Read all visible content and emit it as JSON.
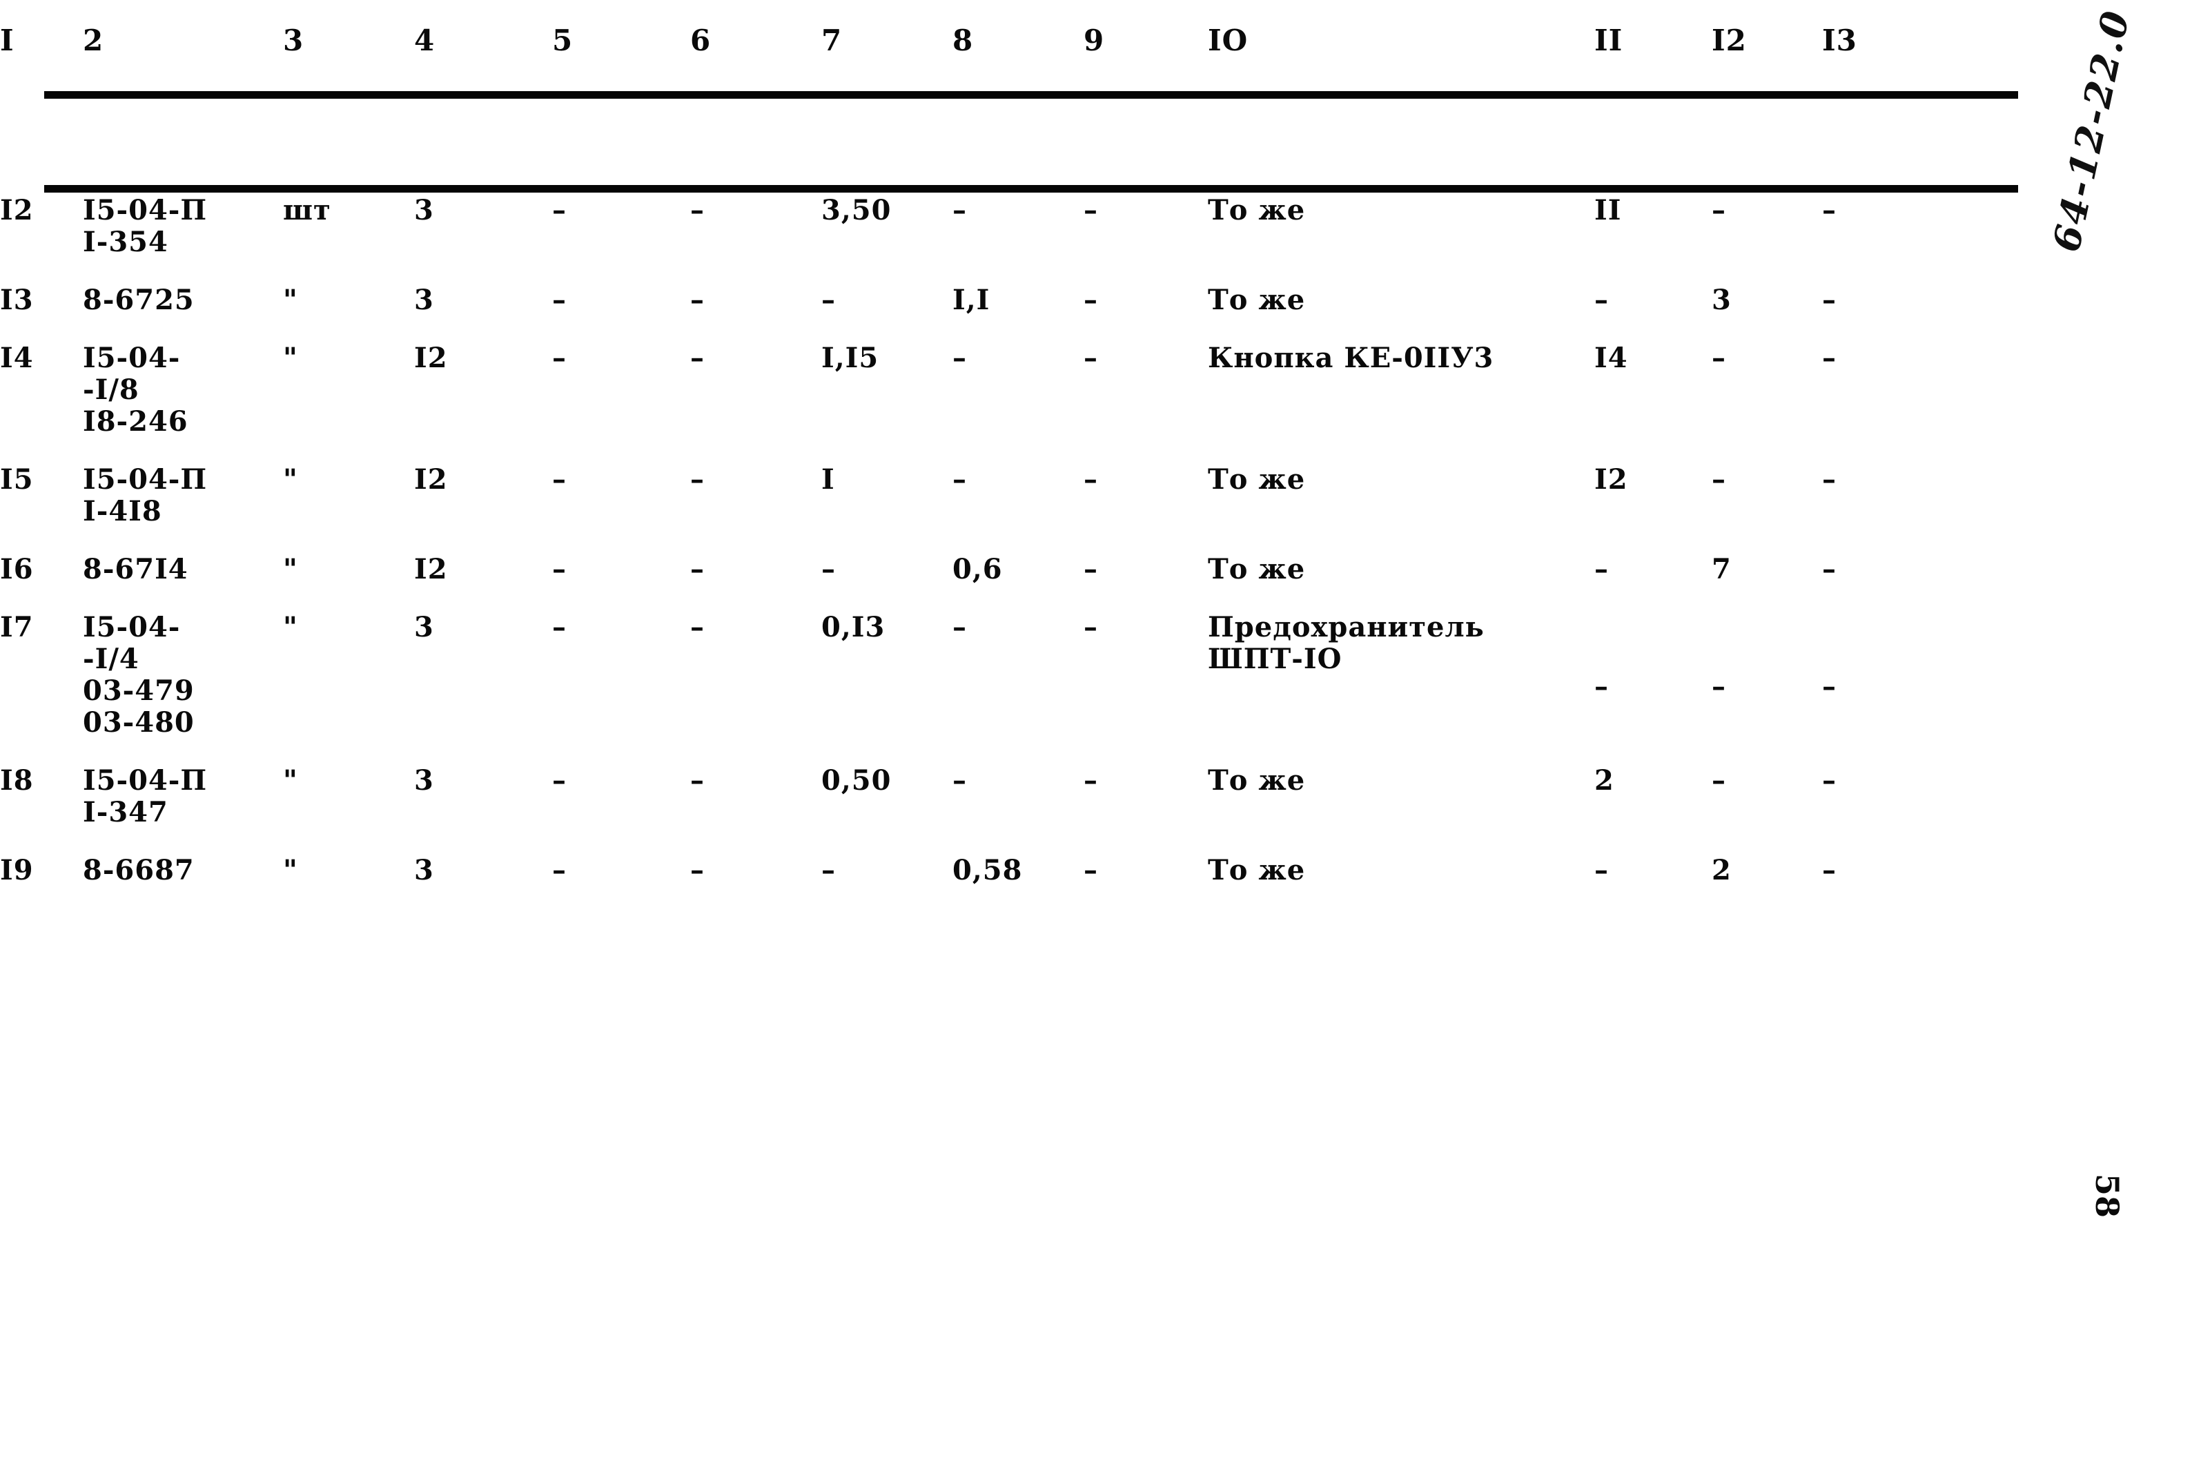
{
  "document": {
    "page_number": "58",
    "margin_note": "64-12-22.0"
  },
  "table": {
    "column_headers": [
      "I",
      "2",
      "3",
      "4",
      "5",
      "6",
      "7",
      "8",
      "9",
      "IO",
      "II",
      "I2",
      "I3"
    ],
    "rows": [
      {
        "c1": "I2",
        "c2_lines": [
          "I5-04-П",
          "I-354"
        ],
        "c3": "шт",
        "c4": "3",
        "c5": "–",
        "c6": "–",
        "c7": "3,50",
        "c8": "–",
        "c9": "–",
        "c10_lines": [
          "То же"
        ],
        "c11": "II",
        "c12": "–",
        "c13": "–"
      },
      {
        "c1": "I3",
        "c2_lines": [
          "8-6725"
        ],
        "c3": "\"",
        "c4": "3",
        "c5": "–",
        "c6": "–",
        "c7": "–",
        "c8": "I,I",
        "c9": "–",
        "c10_lines": [
          "То же"
        ],
        "c11": "–",
        "c12": "3",
        "c13": "–"
      },
      {
        "c1": "I4",
        "c2_lines": [
          "I5-04-",
          "-I/8",
          "I8-246"
        ],
        "c3": "\"",
        "c4": "I2",
        "c5": "–",
        "c6": "–",
        "c7": "I,I5",
        "c8": "–",
        "c9": "–",
        "c10_lines": [
          "Кнопка КЕ-0IIУ3"
        ],
        "c11": "I4",
        "c12": "–",
        "c13": "–"
      },
      {
        "c1": "I5",
        "c2_lines": [
          "I5-04-П",
          "I-4I8"
        ],
        "c3": "\"",
        "c4": "I2",
        "c5": "–",
        "c6": "–",
        "c7": "I",
        "c8": "–",
        "c9": "–",
        "c10_lines": [
          "То же"
        ],
        "c11": "I2",
        "c12": "–",
        "c13": "–"
      },
      {
        "c1": "I6",
        "c2_lines": [
          "8-67I4"
        ],
        "c3": "\"",
        "c4": "I2",
        "c5": "–",
        "c6": "–",
        "c7": "–",
        "c8": "0,6",
        "c9": "–",
        "c10_lines": [
          "То же"
        ],
        "c11": "–",
        "c12": "7",
        "c13": "–"
      },
      {
        "c1": "I7",
        "c2_lines": [
          "I5-04-",
          "-I/4",
          "03-479",
          "03-480"
        ],
        "c3": "\"",
        "c4": "3",
        "c5": "–",
        "c6": "–",
        "c7": "0,I3",
        "c8": "–",
        "c9": "–",
        "c10_lines": [
          "Предохранитель",
          "ШПТ-IO"
        ],
        "c11": "–",
        "c12": "–",
        "c13": "–",
        "right_low": true
      },
      {
        "c1": "I8",
        "c2_lines": [
          "I5-04-П",
          "I-347"
        ],
        "c3": "\"",
        "c4": "3",
        "c5": "–",
        "c6": "–",
        "c7": "0,50",
        "c8": "–",
        "c9": "–",
        "c10_lines": [
          "То же"
        ],
        "c11": "2",
        "c12": "–",
        "c13": "–"
      },
      {
        "c1": "I9",
        "c2_lines": [
          "8-6687"
        ],
        "c3": "\"",
        "c4": "3",
        "c5": "–",
        "c6": "–",
        "c7": "–",
        "c8": "0,58",
        "c9": "–",
        "c10_lines": [
          "То же"
        ],
        "c11": "–",
        "c12": "2",
        "c13": "–"
      }
    ]
  }
}
